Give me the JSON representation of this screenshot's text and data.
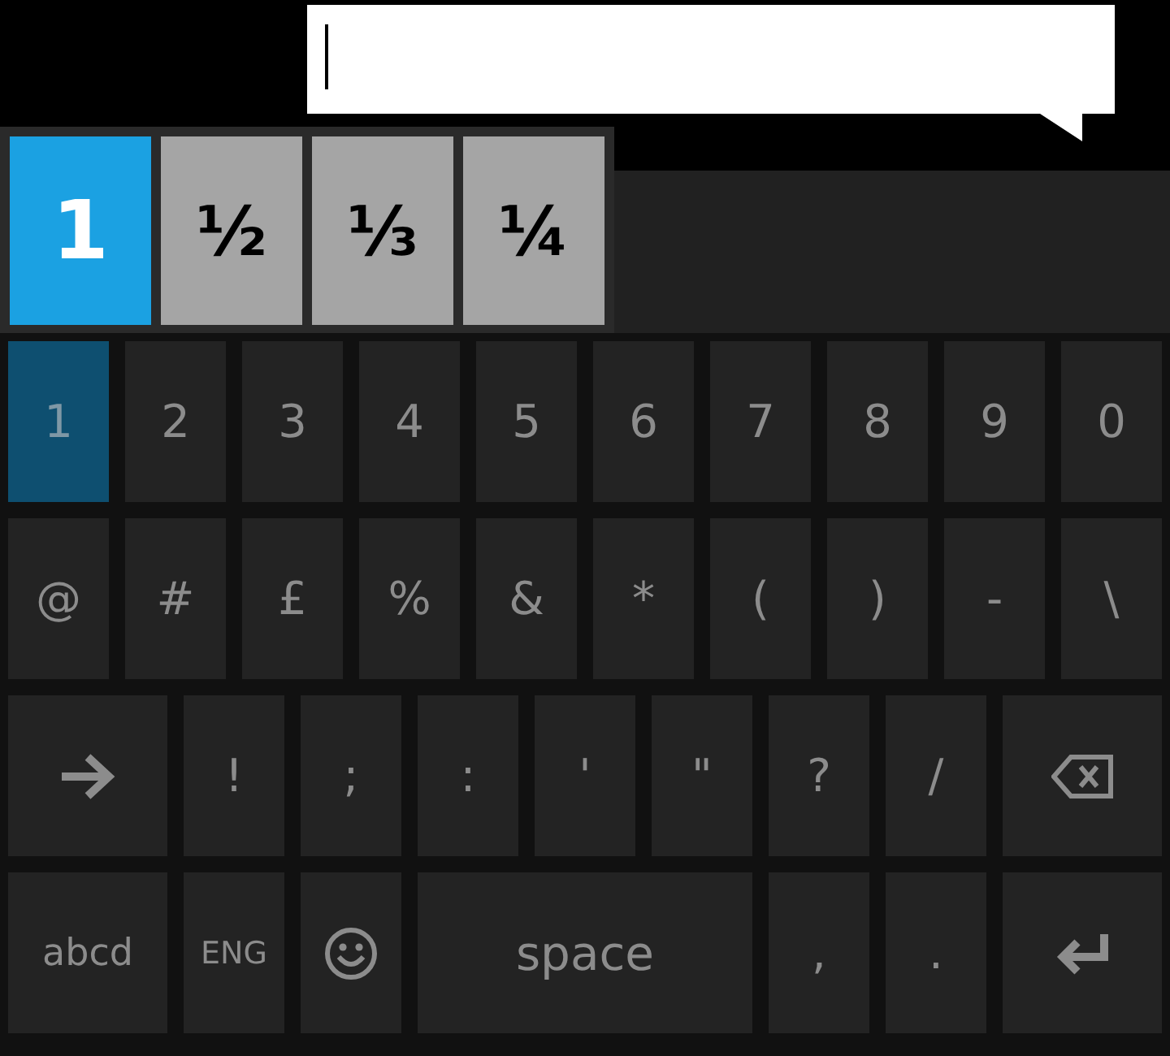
{
  "text_field": {
    "focused": true
  },
  "suggestions": [
    {
      "label": "1",
      "selected": true
    },
    {
      "label": "½",
      "selected": false
    },
    {
      "label": "⅓",
      "selected": false
    },
    {
      "label": "¼",
      "selected": false
    }
  ],
  "keyboard": {
    "rows": [
      {
        "keys": [
          {
            "kind": "char",
            "label": "1",
            "pressed": true
          },
          {
            "kind": "char",
            "label": "2",
            "pressed": false
          },
          {
            "kind": "char",
            "label": "3",
            "pressed": false
          },
          {
            "kind": "char",
            "label": "4",
            "pressed": false
          },
          {
            "kind": "char",
            "label": "5",
            "pressed": false
          },
          {
            "kind": "char",
            "label": "6",
            "pressed": false
          },
          {
            "kind": "char",
            "label": "7",
            "pressed": false
          },
          {
            "kind": "char",
            "label": "8",
            "pressed": false
          },
          {
            "kind": "char",
            "label": "9",
            "pressed": false
          },
          {
            "kind": "char",
            "label": "0",
            "pressed": false
          }
        ]
      },
      {
        "keys": [
          {
            "kind": "char",
            "label": "@",
            "pressed": false
          },
          {
            "kind": "char",
            "label": "#",
            "pressed": false
          },
          {
            "kind": "char",
            "label": "£",
            "pressed": false
          },
          {
            "kind": "char",
            "label": "%",
            "pressed": false
          },
          {
            "kind": "char",
            "label": "&",
            "pressed": false
          },
          {
            "kind": "char",
            "label": "*",
            "pressed": false
          },
          {
            "kind": "char",
            "label": "(",
            "pressed": false
          },
          {
            "kind": "char",
            "label": ")",
            "pressed": false
          },
          {
            "kind": "char",
            "label": "-",
            "pressed": false
          },
          {
            "kind": "char",
            "label": "\\",
            "pressed": false
          }
        ]
      },
      {
        "keys": [
          {
            "kind": "arrow",
            "pressed": false
          },
          {
            "kind": "char",
            "label": "!",
            "pressed": false
          },
          {
            "kind": "char",
            "label": ";",
            "pressed": false
          },
          {
            "kind": "char",
            "label": ":",
            "pressed": false
          },
          {
            "kind": "char",
            "label": "'",
            "pressed": false
          },
          {
            "kind": "char",
            "label": "\"",
            "pressed": false
          },
          {
            "kind": "char",
            "label": "?",
            "pressed": false
          },
          {
            "kind": "char",
            "label": "/",
            "pressed": false
          },
          {
            "kind": "backspace",
            "pressed": false
          }
        ]
      },
      {
        "keys": [
          {
            "kind": "mode",
            "label": "abcd",
            "pressed": false
          },
          {
            "kind": "language",
            "label": "ENG",
            "pressed": false
          },
          {
            "kind": "emoji",
            "pressed": false
          },
          {
            "kind": "space",
            "label": "space",
            "pressed": false
          },
          {
            "kind": "char",
            "label": ",",
            "pressed": false
          },
          {
            "kind": "char",
            "label": ".",
            "pressed": false
          },
          {
            "kind": "enter",
            "pressed": false
          }
        ]
      }
    ]
  }
}
